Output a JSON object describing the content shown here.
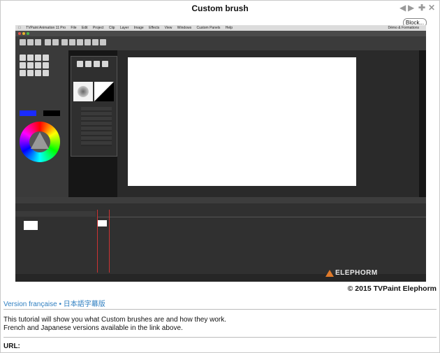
{
  "window": {
    "title": "Custom brush",
    "controls": [
      "back-arrow-icon",
      "forward-arrow-icon",
      "plus-icon",
      "close-icon"
    ],
    "block_label": "Block..."
  },
  "video": {
    "app_menu": [
      "TVPaint Animation 11 Pro",
      "File",
      "Edit",
      "Project",
      "Clip",
      "Layer",
      "Image",
      "Effects",
      "View",
      "Windows",
      "Custom Panels",
      "Help"
    ],
    "app_menu_right": "Démo & Formations",
    "logo_text": "ELEPHORM"
  },
  "footer": {
    "copyright": "© 2015 TVPaint Elephorm",
    "link_french": "Version française",
    "link_separator": "•",
    "link_japanese": "日本語字幕版",
    "description_line1": "This tutorial will show you what Custom brushes are and how they work.",
    "description_line2": "French and Japanese versions available in the link above.",
    "url_label": "URL:"
  },
  "colors": {
    "link": "#2f7fc1",
    "canvas": "#ffffff",
    "app_dark": "#303030",
    "logo_accent": "#e07a2a"
  }
}
